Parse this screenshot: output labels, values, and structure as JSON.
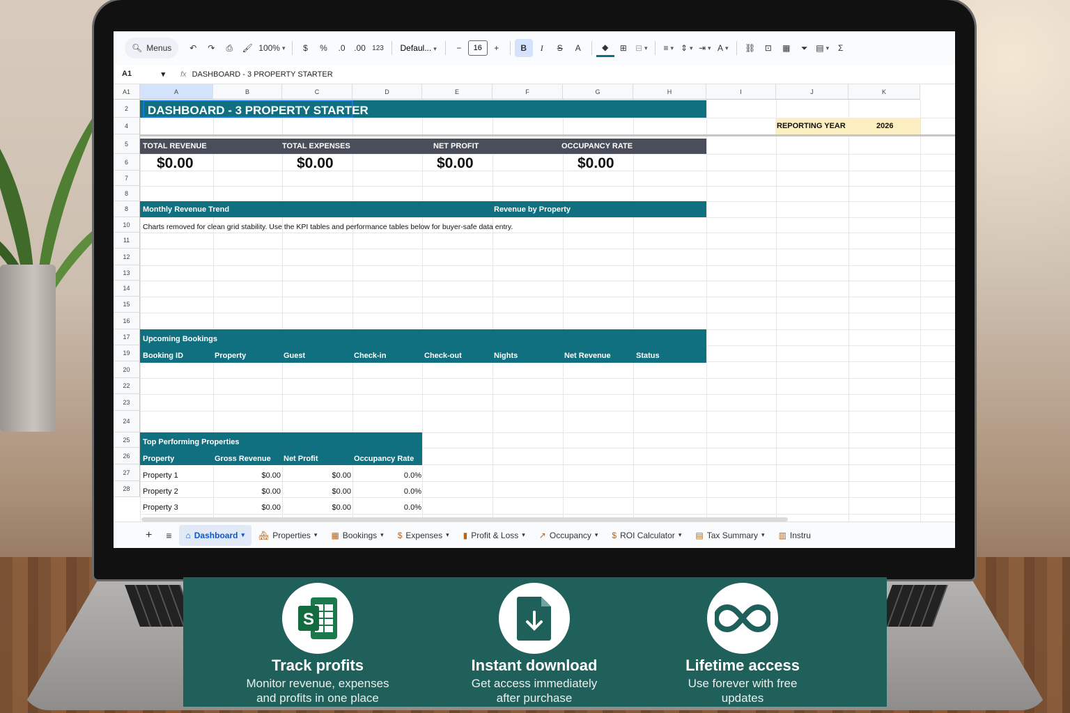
{
  "toolbar": {
    "search_label": "Menus",
    "zoom": "100%",
    "currency": "$",
    "percent": "%",
    "dec_less": ".0",
    "dec_more": ".00",
    "number_format": "123",
    "font": "Defaul...",
    "font_size": "16",
    "bold": "B",
    "italic": "I",
    "strike": "S",
    "text_color": "A",
    "sum": "Σ"
  },
  "formula_bar": {
    "cell_ref": "A1",
    "content": "DASHBOARD - 3 PROPERTY STARTER"
  },
  "columns": [
    "A1",
    "A",
    "B",
    "C",
    "D",
    "E",
    "F",
    "G",
    "H",
    "I",
    "J",
    "K"
  ],
  "rows": [
    "2",
    "4",
    "5",
    "6",
    "7",
    "8",
    "8",
    "10",
    "11",
    "12",
    "13",
    "14",
    "15",
    "16",
    "17",
    "19",
    "20",
    "22",
    "23",
    "24",
    "25",
    "26",
    "27",
    "28"
  ],
  "sheet": {
    "title": "DASHBOARD - 3 PROPERTY STARTER",
    "reporting_year_label": "REPORTING YEAR",
    "reporting_year": "2026",
    "kpis": [
      {
        "label": "TOTAL REVENUE",
        "value": "$0.00"
      },
      {
        "label": "TOTAL EXPENSES",
        "value": "$0.00"
      },
      {
        "label": "NET PROFIT",
        "value": "$0.00"
      },
      {
        "label": "OCCUPANCY RATE",
        "value": "$0.00"
      }
    ],
    "monthly_trend_label": "Monthly Revenue Trend",
    "revenue_by_property_label": "Revenue by Property",
    "note": "Charts removed for clean grid stability. Use the KPI tables and performance tables below for buyer-safe data entry.",
    "bookings": {
      "title": "Upcoming Bookings",
      "headers": [
        "Booking ID",
        "Property",
        "Guest",
        "Check-in",
        "Check-out",
        "Nights",
        "Net Revenue",
        "Status"
      ]
    },
    "top_properties": {
      "title": "Top Performing Properties",
      "headers": [
        "Property",
        "Gross Revenue",
        "Net Profit",
        "Occupancy Rate"
      ],
      "rows": [
        [
          "Property 1",
          "$0.00",
          "$0.00",
          "0.0%"
        ],
        [
          "Property 2",
          "$0.00",
          "$0.00",
          "0.0%"
        ],
        [
          "Property 3",
          "$0.00",
          "$0.00",
          "0.0%"
        ]
      ]
    }
  },
  "tabs": [
    {
      "label": "Dashboard",
      "icon": "house-icon",
      "active": true
    },
    {
      "label": "Properties",
      "icon": "building-icon"
    },
    {
      "label": "Bookings",
      "icon": "calendar-icon"
    },
    {
      "label": "Expenses",
      "icon": "money-icon"
    },
    {
      "label": "Profit & Loss",
      "icon": "bar-chart-icon"
    },
    {
      "label": "Occupancy",
      "icon": "trend-icon"
    },
    {
      "label": "ROI Calculator",
      "icon": "moneybag-icon"
    },
    {
      "label": "Tax Summary",
      "icon": "clipboard-icon"
    },
    {
      "label": "Instru",
      "icon": "book-icon"
    }
  ],
  "banner": {
    "features": [
      {
        "title": "Track profits",
        "line1": "Monitor revenue, expenses",
        "line2": "and profits in one place",
        "icon": "sheets-icon"
      },
      {
        "title": "Instant download",
        "line1": "Get access immediately",
        "line2": "after purchase",
        "icon": "download-file-icon"
      },
      {
        "title": "Lifetime access",
        "line1": "Use forever with free",
        "line2": "updates",
        "icon": "infinity-icon"
      }
    ]
  },
  "colors": {
    "teal": "#10707f",
    "slate": "#4a4e5a",
    "banner": "#20605a",
    "year_bg": "#fbeec1"
  }
}
